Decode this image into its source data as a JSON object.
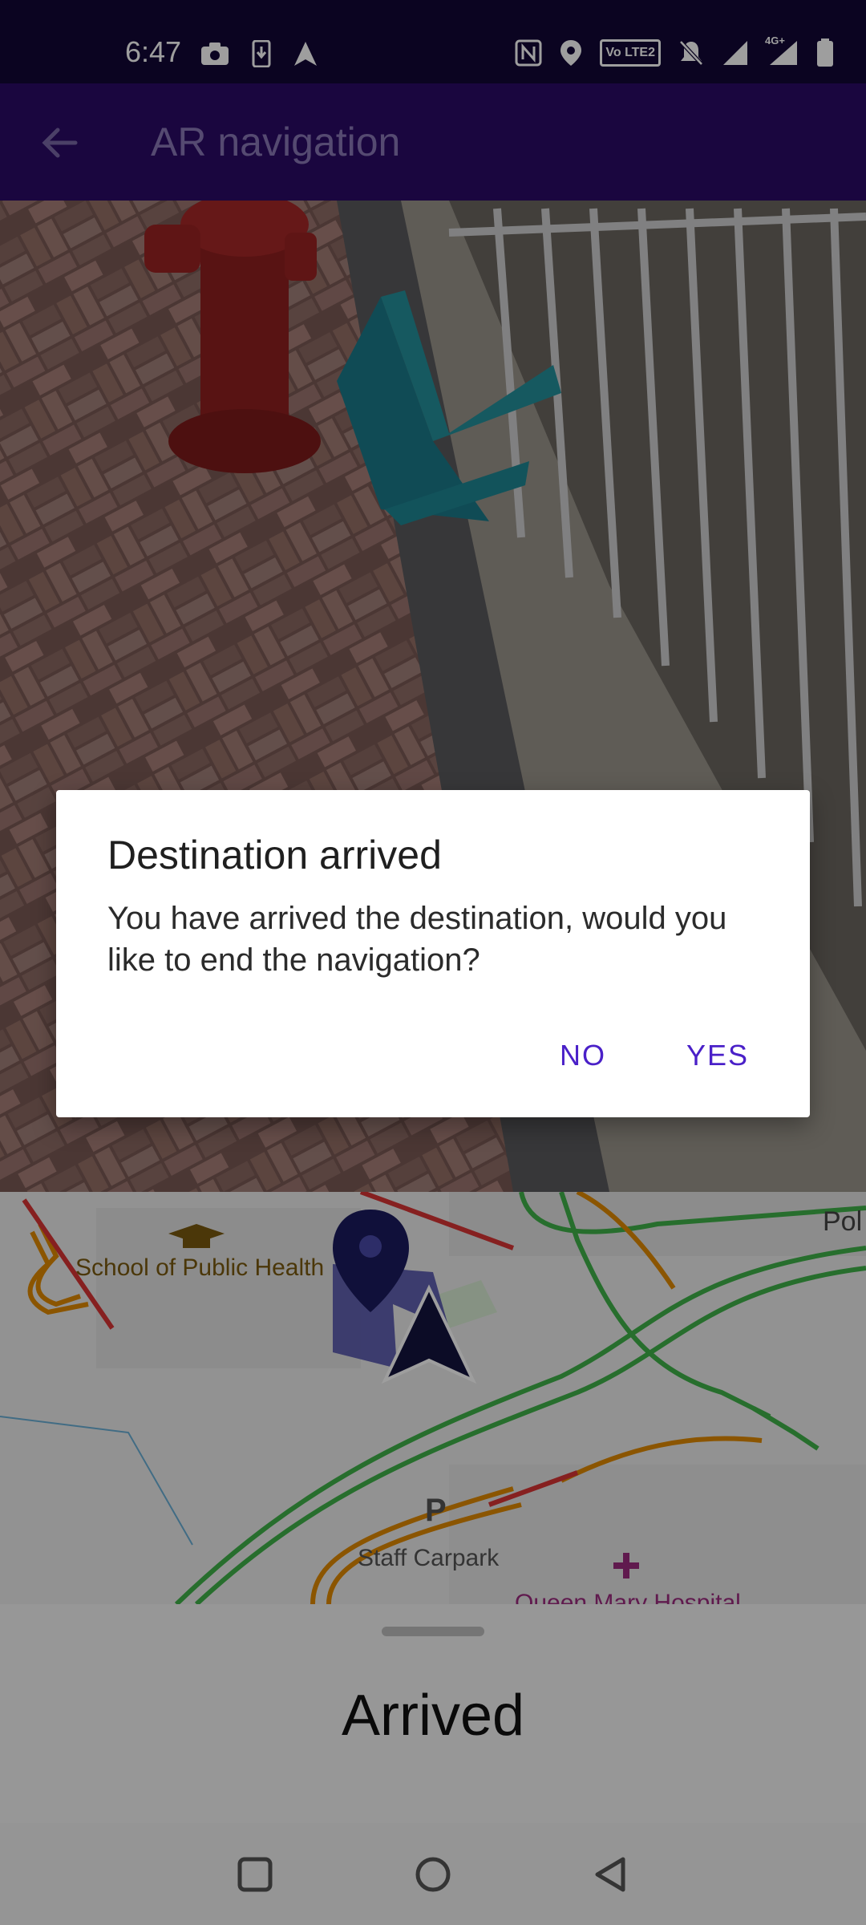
{
  "status_bar": {
    "time": "6:47",
    "left_icons": [
      "camera-icon",
      "download-icon",
      "navigation-icon"
    ],
    "right_icons": [
      "nfc-icon",
      "location-icon",
      "volte-icon",
      "mute-icon",
      "signal-icon",
      "signal-4g-icon",
      "battery-icon"
    ],
    "volte_label": "Vo LTE2",
    "network_label": "4G+"
  },
  "app_bar": {
    "title": "AR navigation",
    "color": "#2a0a66"
  },
  "map": {
    "labels": {
      "school": "School of Public Health",
      "carpark": "Staff Carpark",
      "hospital": "Queen Mary Hospital",
      "edge_text": "Pol"
    }
  },
  "dialog": {
    "title": "Destination arrived",
    "message": "You have arrived the destination, would you like to end the navigation?",
    "no_label": "NO",
    "yes_label": "YES",
    "accent": "#4a20c8"
  },
  "bottom_sheet": {
    "status": "Arrived"
  }
}
